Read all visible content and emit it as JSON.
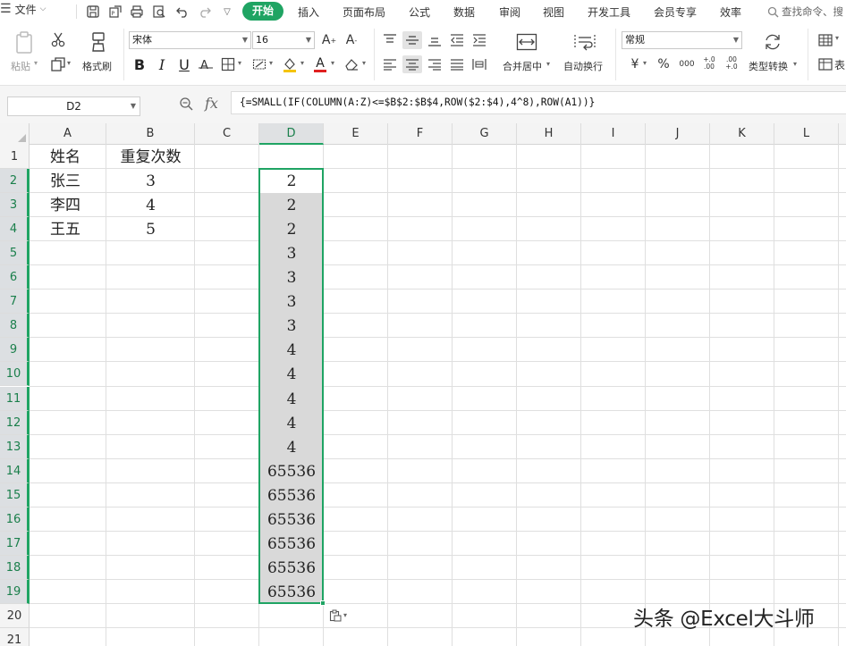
{
  "menubar": {
    "file_label": "文件",
    "tabs": [
      "开始",
      "插入",
      "页面布局",
      "公式",
      "数据",
      "审阅",
      "视图",
      "开发工具",
      "会员专享",
      "效率"
    ],
    "search_placeholder": "查找命令、搜",
    "quick_access_icons": [
      "save-icon",
      "export-icon",
      "print-icon",
      "print-preview-icon",
      "undo-icon",
      "redo-icon",
      "more-icon"
    ]
  },
  "ribbon": {
    "paste_label": "粘贴",
    "format_painter_label": "格式刷",
    "font_name": "宋体",
    "font_size": "16",
    "merge_label": "合并居中",
    "wrap_label": "自动换行",
    "number_format": "常规",
    "type_convert_label": "类型转换",
    "cut_icon": "scissors-icon",
    "copy_icon": "copy-icon",
    "bold": "B",
    "italic": "I",
    "underline": "U",
    "font_color_glyph": "A",
    "currency": "¥",
    "percent": "%",
    "thousands": "000",
    "inc_decimal": "+.0 .00",
    "dec_decimal": ".00 +.0",
    "extra_label": "表"
  },
  "formula_bar": {
    "name_box": "D2",
    "fx": "fx",
    "formula": "{=SMALL(IF(COLUMN(A:Z)<=$B$2:$B$4,ROW($2:$4),4^8),ROW(A1))}"
  },
  "sheet": {
    "columns": [
      "A",
      "B",
      "C",
      "D",
      "E",
      "F",
      "G",
      "H",
      "I",
      "J",
      "K",
      "L"
    ],
    "active_column": "D",
    "rows": [
      "1",
      "2",
      "3",
      "4",
      "5",
      "6",
      "7",
      "8",
      "9",
      "10",
      "11",
      "12",
      "13",
      "14",
      "15",
      "16",
      "17",
      "18",
      "19",
      "20",
      "21"
    ],
    "headers": {
      "a1": "姓名",
      "b1": "重复次数"
    },
    "names": [
      "张三",
      "李四",
      "王五"
    ],
    "counts": [
      "3",
      "4",
      "5"
    ],
    "d_values": [
      "2",
      "2",
      "2",
      "3",
      "3",
      "3",
      "3",
      "4",
      "4",
      "4",
      "4",
      "4",
      "65536",
      "65536",
      "65536",
      "65536",
      "65536",
      "65536"
    ]
  },
  "watermark": "头条 @Excel大斗师",
  "colors": {
    "accent": "#1fa463",
    "selection_fill": "#d9d9d9"
  }
}
